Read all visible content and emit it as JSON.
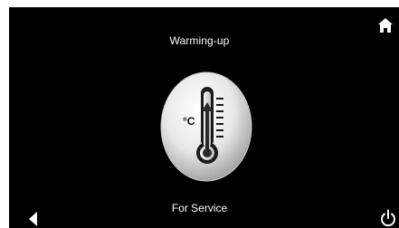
{
  "screen": {
    "title": "Warming-up",
    "footer_label": "For Service"
  },
  "thermometer": {
    "unit": "°C",
    "icon": "thermometer-icon"
  },
  "navigation": {
    "home_icon": "home-icon",
    "back_icon": "back-arrow-icon",
    "power_icon": "power-icon"
  },
  "colors": {
    "background": "#000000",
    "text": "#ffffff",
    "accent": "#ffffff"
  }
}
